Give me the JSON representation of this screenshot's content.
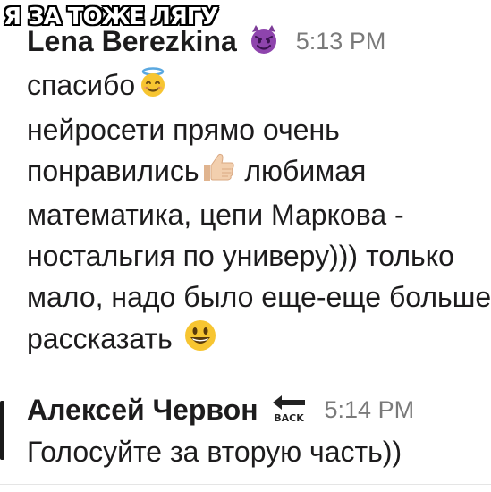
{
  "caption": "Я ЗА ТОЖЕ ЛЯГУ",
  "messages": [
    {
      "author": "Lena Berezkina",
      "status_icon": "smiling-devil-icon",
      "time": "5:13 PM",
      "lines": {
        "l1": "спасибо",
        "l2": "нейросети прямо очень",
        "l3a": "понравились",
        "l3b": " любимая",
        "l4": "математика, цепи Маркова -",
        "l5": "ностальгия по универу))) только",
        "l6": "мало, надо было еще-еще больше",
        "l7": "рассказать "
      },
      "emojis": [
        "smiling-halo-icon",
        "thumbs-up-icon",
        "grinning-face-icon"
      ]
    },
    {
      "author": "Алексей Червон",
      "status_icon": "back-arrow-icon",
      "status_icon_text": "BACK",
      "time": "5:14 PM",
      "lines": {
        "l1": "Голосуйте за вторую часть))"
      }
    }
  ],
  "colors": {
    "text": "#1d1c1d",
    "timestamp": "#7a7a7a",
    "emoji_yellow": "#f7c531",
    "devil_purple": "#8e44ad",
    "halo_blue": "#5aa8e0",
    "thumb_skin": "#f2cfae"
  }
}
